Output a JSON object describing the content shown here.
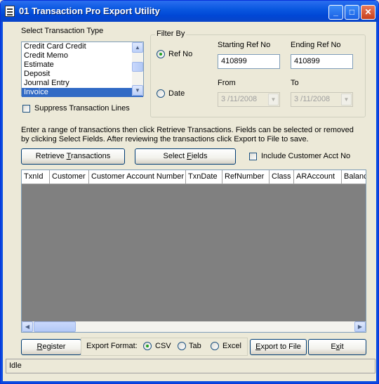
{
  "window": {
    "title": "01 Transaction Pro Export Utility",
    "minimize_glyph": "_",
    "maximize_glyph": "□",
    "close_glyph": "✕"
  },
  "transaction_type": {
    "label": "Select Transaction Type",
    "items": [
      "Credit Card Credit",
      "Credit Memo",
      "Estimate",
      "Deposit",
      "Journal Entry",
      "Invoice"
    ],
    "selected": "Invoice",
    "suppress_label": "Suppress Transaction Lines"
  },
  "filter": {
    "group_label": "Filter By",
    "ref_no_label": "Ref No",
    "date_label": "Date",
    "starting_ref_label": "Starting Ref No",
    "ending_ref_label": "Ending Ref No",
    "starting_ref_value": "410899",
    "ending_ref_value": "410899",
    "from_label": "From",
    "to_label": "To",
    "from_value": "3 /11/2008",
    "to_value": "3 /11/2008"
  },
  "instructions": "Enter a range of transactions then click Retrieve Transactions. Fields can be selected or removed by clicking Select Fields. After reviewing the transactions click Export to File to save.",
  "actions": {
    "retrieve_pre": "Retrieve ",
    "retrieve_u": "T",
    "retrieve_post": "ransactions",
    "select_pre": "Select ",
    "select_u": "F",
    "select_post": "ields",
    "include_customer_label": "Include Customer Acct No"
  },
  "grid": {
    "columns": [
      "TxnId",
      "Customer",
      "Customer Account Number",
      "TxnDate",
      "RefNumber",
      "Class",
      "ARAccount",
      "Balance"
    ]
  },
  "bottom": {
    "register_u": "R",
    "register_post": "egister",
    "export_format_label": "Export Format:",
    "csv_label": "CSV",
    "tab_label": "Tab",
    "excel_label": "Excel",
    "export_u": "E",
    "export_post": "xport to File",
    "exit_pre": "E",
    "exit_u": "x",
    "exit_post": "it"
  },
  "status": {
    "text": "Idle"
  }
}
